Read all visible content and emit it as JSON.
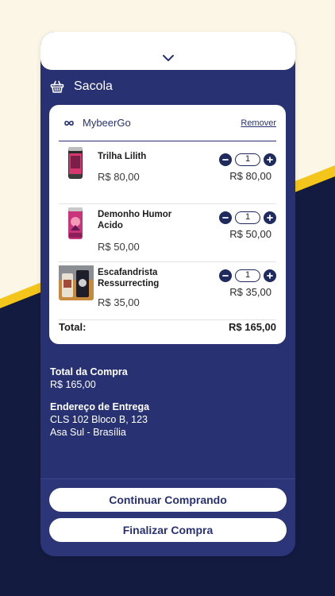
{
  "colors": {
    "navy": "#283272",
    "dark_navy": "#131b40",
    "yellow": "#f4c51b",
    "cream": "#fbf6e6"
  },
  "header": {
    "icon": "chevron-down-icon"
  },
  "cart": {
    "title": "Sacola",
    "icon": "basket-icon"
  },
  "shop": {
    "name": "MybeerGo",
    "logo": "infinity-logo-icon",
    "remove_label": "Remover"
  },
  "items": [
    {
      "name": "Trilha Lilith",
      "price": "R$ 80,00",
      "qty": "1",
      "subtotal": "R$ 80,00"
    },
    {
      "name": "Demonho Humor Acido",
      "price": "R$ 50,00",
      "qty": "1",
      "subtotal": "R$ 50,00"
    },
    {
      "name": "Escafandrista Ressurrecting",
      "price": "R$ 35,00",
      "qty": "1",
      "subtotal": "R$ 35,00"
    }
  ],
  "total": {
    "label": "Total:",
    "value": "R$ 165,00"
  },
  "summary": {
    "purchase_label": "Total da Compra",
    "purchase_value": "R$ 165,00",
    "address_label": "Endereço de Entrega",
    "address_line1": "CLS 102 Bloco B, 123",
    "address_line2": "Asa Sul - Brasília"
  },
  "actions": {
    "continue_label": "Continuar Comprando",
    "checkout_label": "Finalizar Compra"
  }
}
